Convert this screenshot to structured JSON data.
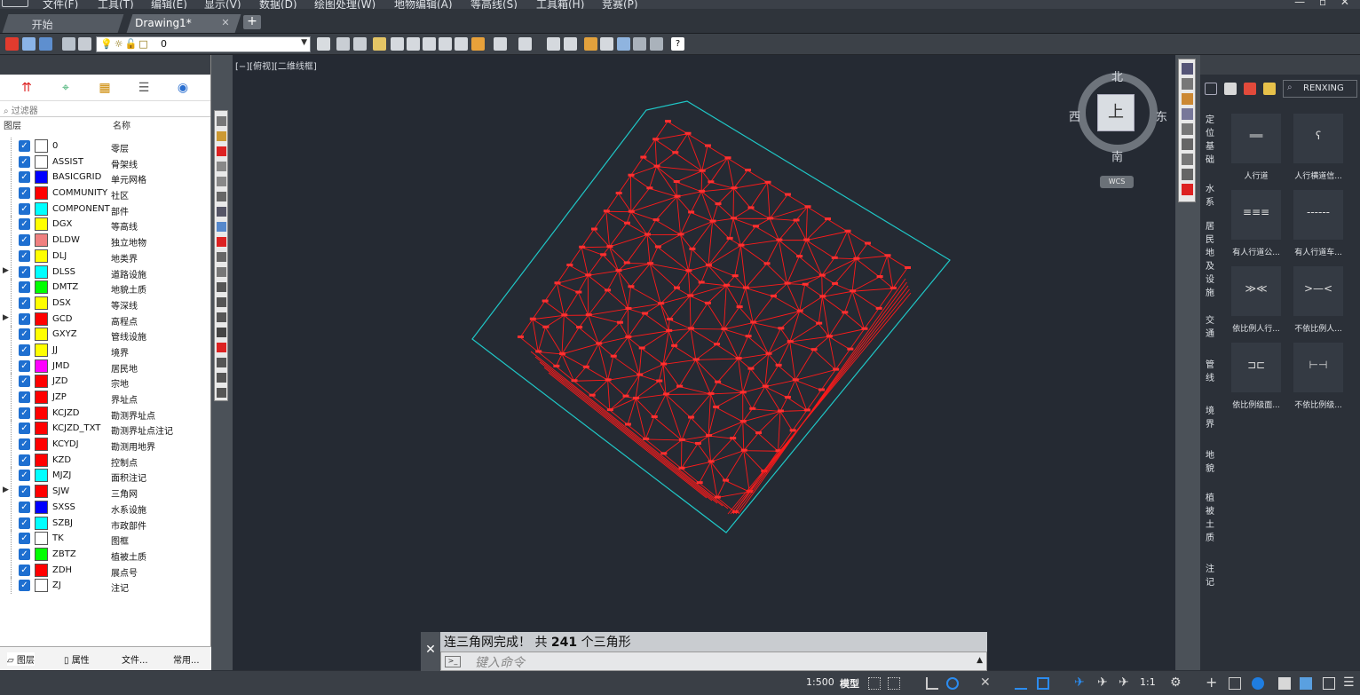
{
  "menu": [
    "文件(F)",
    "工具(T)",
    "编辑(E)",
    "显示(V)",
    "数据(D)",
    "绘图处理(W)",
    "地物编辑(A)",
    "等高线(S)",
    "工具箱(H)",
    "竞赛(P)"
  ],
  "tabs": [
    {
      "label": "开始",
      "active": false
    },
    {
      "label": "Drawing1*",
      "active": true
    }
  ],
  "toolbar": {
    "current_layer": "0"
  },
  "layer_panel": {
    "filter_placeholder": "过滤器",
    "col_layer": "图层",
    "col_name": "名称",
    "layers": [
      {
        "name": "0",
        "desc": "零层",
        "color": "#ffffff",
        "expand": false
      },
      {
        "name": "ASSIST",
        "desc": "骨架线",
        "color": "#ffffff",
        "expand": false
      },
      {
        "name": "BASICGRID",
        "desc": "单元网格",
        "color": "#0000ff",
        "expand": false
      },
      {
        "name": "COMMUNITY",
        "desc": "社区",
        "color": "#ff0000",
        "expand": false
      },
      {
        "name": "COMPONENT",
        "desc": "部件",
        "color": "#00ffff",
        "expand": false
      },
      {
        "name": "DGX",
        "desc": "等高线",
        "color": "#ffff00",
        "expand": false
      },
      {
        "name": "DLDW",
        "desc": "独立地物",
        "color": "#f08080",
        "expand": false
      },
      {
        "name": "DLJ",
        "desc": "地类界",
        "color": "#ffff00",
        "expand": false
      },
      {
        "name": "DLSS",
        "desc": "道路设施",
        "color": "#00ffff",
        "expand": true
      },
      {
        "name": "DMTZ",
        "desc": "地貌土质",
        "color": "#00ff00",
        "expand": false
      },
      {
        "name": "DSX",
        "desc": "等深线",
        "color": "#ffff00",
        "expand": false
      },
      {
        "name": "GCD",
        "desc": "高程点",
        "color": "#ff0000",
        "expand": true
      },
      {
        "name": "GXYZ",
        "desc": "管线设施",
        "color": "#ffff00",
        "expand": false
      },
      {
        "name": "JJ",
        "desc": "境界",
        "color": "#ffff00",
        "expand": false
      },
      {
        "name": "JMD",
        "desc": "居民地",
        "color": "#ff00ff",
        "expand": false
      },
      {
        "name": "JZD",
        "desc": "宗地",
        "color": "#ff0000",
        "expand": false
      },
      {
        "name": "JZP",
        "desc": "界址点",
        "color": "#ff0000",
        "expand": false
      },
      {
        "name": "KCJZD",
        "desc": "勘测界址点",
        "color": "#ff0000",
        "expand": false
      },
      {
        "name": "KCJZD_TXT",
        "desc": "勘测界址点注记",
        "color": "#ff0000",
        "expand": false
      },
      {
        "name": "KCYDJ",
        "desc": "勘测用地界",
        "color": "#ff0000",
        "expand": false
      },
      {
        "name": "KZD",
        "desc": "控制点",
        "color": "#ff0000",
        "expand": false
      },
      {
        "name": "MJZJ",
        "desc": "面积注记",
        "color": "#00ffff",
        "expand": false
      },
      {
        "name": "SJW",
        "desc": "三角网",
        "color": "#ff0000",
        "expand": true
      },
      {
        "name": "SXSS",
        "desc": "水系设施",
        "color": "#0000ff",
        "expand": false
      },
      {
        "name": "SZBJ",
        "desc": "市政部件",
        "color": "#00ffff",
        "expand": false
      },
      {
        "name": "TK",
        "desc": "图框",
        "color": "#ffffff",
        "expand": false
      },
      {
        "name": "ZBTZ",
        "desc": "植被土质",
        "color": "#00ff00",
        "expand": false
      },
      {
        "name": "ZDH",
        "desc": "展点号",
        "color": "#ff0000",
        "expand": false
      },
      {
        "name": "ZJ",
        "desc": "注记",
        "color": "#ffffff",
        "expand": false
      }
    ],
    "footer_tabs": [
      "图层",
      "属性",
      "文件...",
      "常用..."
    ]
  },
  "viewport": {
    "label": "[−][俯视][二维线框]",
    "compass": {
      "north": "北",
      "south": "南",
      "east": "东",
      "west": "西",
      "top": "上"
    },
    "wcs": "WCS"
  },
  "symbol_panel": {
    "search_value": "RENXING",
    "categories": [
      "定位基础",
      "水系",
      "居民地及设施",
      "交通",
      "管线",
      "境界",
      "地貌",
      "植被土质",
      "注记"
    ],
    "symbols": [
      "人行道",
      "人行横道信...",
      "有人行道公...",
      "有人行道车...",
      "依比例人行...",
      "不依比例人...",
      "依比例级面...",
      "不依比例级..."
    ]
  },
  "command": {
    "history_prefix": "连三角网完成！ 共",
    "history_count": "241",
    "history_suffix": "个三角形",
    "input_placeholder": "键入命令"
  },
  "status": {
    "scale": "1:500",
    "space": "模型",
    "anno_scale": "1:1"
  }
}
